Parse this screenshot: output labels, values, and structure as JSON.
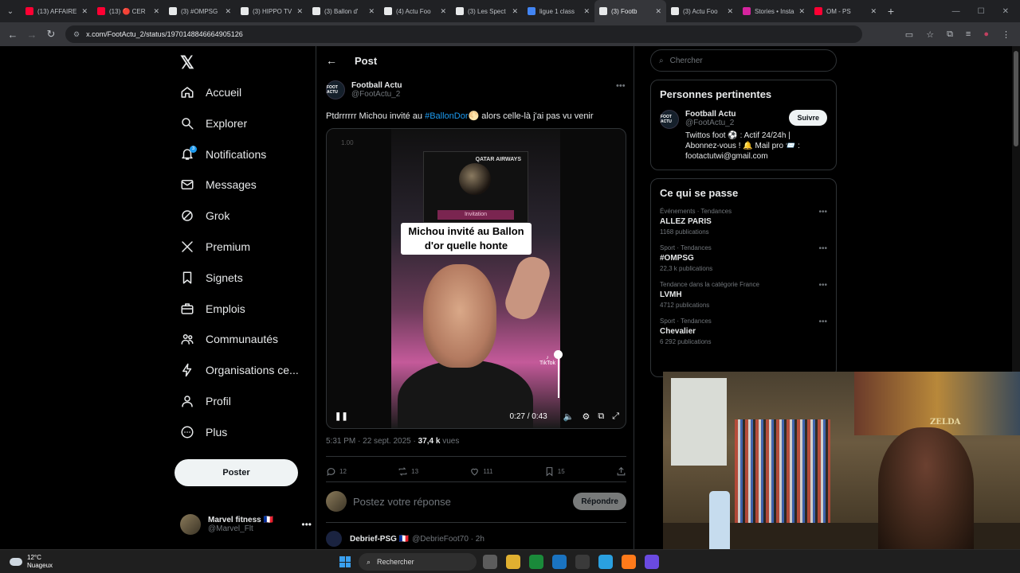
{
  "browser": {
    "tabs": [
      {
        "title": "(13) AFFAIRE",
        "favicon_color": "#ff0033"
      },
      {
        "title": "(13) 🔴 CER",
        "favicon_color": "#ff0033"
      },
      {
        "title": "(3) #OMPSG",
        "favicon_color": "#e7e9ea"
      },
      {
        "title": "(3) HIPPO TV",
        "favicon_color": "#e7e9ea"
      },
      {
        "title": "(3) Ballon d'",
        "favicon_color": "#e7e9ea"
      },
      {
        "title": "(4) Actu Foo",
        "favicon_color": "#e7e9ea"
      },
      {
        "title": "(3) Les Spect",
        "favicon_color": "#e7e9ea"
      },
      {
        "title": "ligue 1 class",
        "favicon_color": "#4285f4"
      },
      {
        "title": "(3) Footb",
        "favicon_color": "#e7e9ea",
        "active": true
      },
      {
        "title": "(3) Actu Foo",
        "favicon_color": "#e7e9ea"
      },
      {
        "title": "Stories • Insta",
        "favicon_color": "#d6249f"
      },
      {
        "title": "OM - PS",
        "favicon_color": "#ff0033"
      }
    ],
    "new_tab": "+",
    "url": "x.com/FootActu_2/status/1970148846664905126"
  },
  "nav": {
    "items": [
      {
        "label": "Accueil",
        "icon": "home-icon"
      },
      {
        "label": "Explorer",
        "icon": "search-icon"
      },
      {
        "label": "Notifications",
        "icon": "bell-icon",
        "badge": "3"
      },
      {
        "label": "Messages",
        "icon": "mail-icon"
      },
      {
        "label": "Grok",
        "icon": "grok-icon"
      },
      {
        "label": "Premium",
        "icon": "x-logo-icon"
      },
      {
        "label": "Signets",
        "icon": "bookmark-icon"
      },
      {
        "label": "Emplois",
        "icon": "briefcase-icon"
      },
      {
        "label": "Communautés",
        "icon": "people-icon"
      },
      {
        "label": "Organisations ce...",
        "icon": "lightning-icon"
      },
      {
        "label": "Profil",
        "icon": "person-icon"
      },
      {
        "label": "Plus",
        "icon": "more-circle-icon"
      }
    ],
    "post_button": "Poster",
    "account": {
      "name": "Marvel fitness 🇫🇷",
      "handle": "@Marvel_Flt"
    }
  },
  "post": {
    "header": "Post",
    "author": {
      "name": "Football Actu",
      "handle": "@FootActu_2",
      "avatar_text": "FOOT ACTU"
    },
    "text_before": "Ptdrrrrrr Michou invité au ",
    "hashtag": "#BallonDor",
    "text_after": "🌕 alors celle-là j'ai pas vu venir",
    "video": {
      "corner_label": "1.00",
      "caption": "Michou invité au Ballon d'or quelle honte",
      "card_brand": "QATAR AIRWAYS",
      "band_text": "Invitation",
      "time": "0:27 / 0:43",
      "tiktok_label": "TikTok",
      "volume_level": 0.95
    },
    "time": "5:31 PM · 22 sept. 2025 · ",
    "views": "37,4 k",
    "views_suffix": " vues",
    "stats": {
      "replies": "12",
      "reposts": "13",
      "likes": "111",
      "bookmarks": "15"
    },
    "reply_placeholder": "Postez votre réponse",
    "reply_button": "Répondre",
    "next_reply": {
      "name": "Debrief-PSG 🇫🇷",
      "handle": "@DebrieFoot70 · 2h"
    }
  },
  "sidebar": {
    "search_placeholder": "Chercher",
    "relevant_title": "Personnes pertinentes",
    "relevant": {
      "name": "Football Actu",
      "handle": "@FootActu_2",
      "bio": "Twittos foot ⚽ : Actif 24/24h | Abonnez-vous ! 🔔 Mail pro 📨 : footactutwi@gmail.com",
      "follow": "Suivre"
    },
    "trends_title": "Ce qui se passe",
    "trends": [
      {
        "category": "Événements · Tendances",
        "name": "ALLEZ PARIS",
        "count": "1168 publications"
      },
      {
        "category": "Sport · Tendances",
        "name": "#OMPSG",
        "count": "22,3 k publications"
      },
      {
        "category": "Tendance dans la catégorie France",
        "name": "LVMH",
        "count": "4712 publications"
      },
      {
        "category": "Sport · Tendances",
        "name": "Chevalier",
        "count": "6 292 publications"
      }
    ]
  },
  "webcam": {
    "poster_text": "ZELDA"
  },
  "taskbar": {
    "temp": "12°C",
    "weather": "Nuageux",
    "search": "Rechercher",
    "app_colors": [
      "#5c5c5c",
      "#e0b030",
      "#1a8a3a",
      "#1a73c0",
      "#3a3a3a",
      "#2aa0e0",
      "#ff7a1a",
      "#6a4ae0"
    ]
  }
}
